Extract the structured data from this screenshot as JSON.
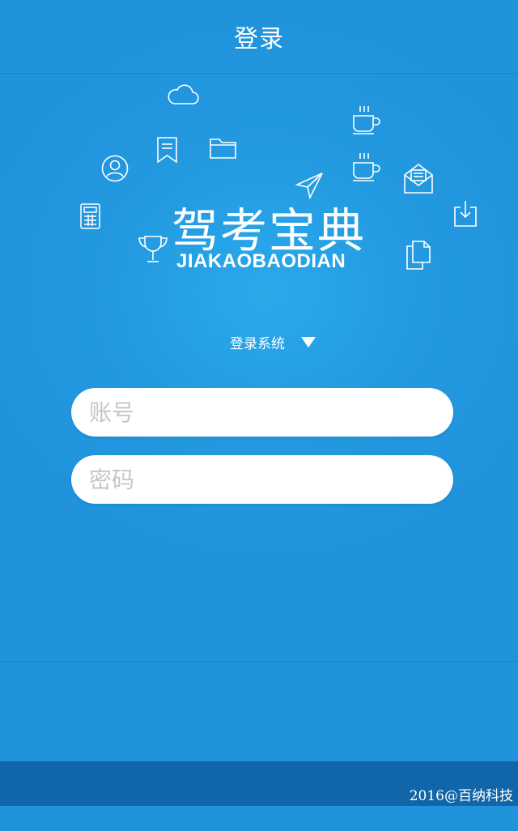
{
  "header": {
    "title": "登录"
  },
  "logo": {
    "name_cn": "驾考宝典",
    "name_en": "JIAKAOBAODIAN"
  },
  "login_section": {
    "label": "登录系统",
    "arrow_icon": "triangle-down-icon"
  },
  "form": {
    "account_placeholder": "账号",
    "account_value": "",
    "password_placeholder": "密码",
    "password_value": ""
  },
  "footer": {
    "copyright": "2016@百纳科技"
  },
  "decor_icons": [
    "cloud-icon",
    "bookmark-icon",
    "folder-icon",
    "user-icon",
    "calculator-icon",
    "trophy-icon",
    "paper-plane-icon",
    "coffee-cup-icon",
    "mail-icon",
    "download-icon",
    "documents-icon"
  ],
  "colors": {
    "background": "#2093dc",
    "footer": "#1066a9",
    "text": "#ffffff",
    "input_bg": "#ffffff",
    "placeholder": "#c6c6c6"
  }
}
